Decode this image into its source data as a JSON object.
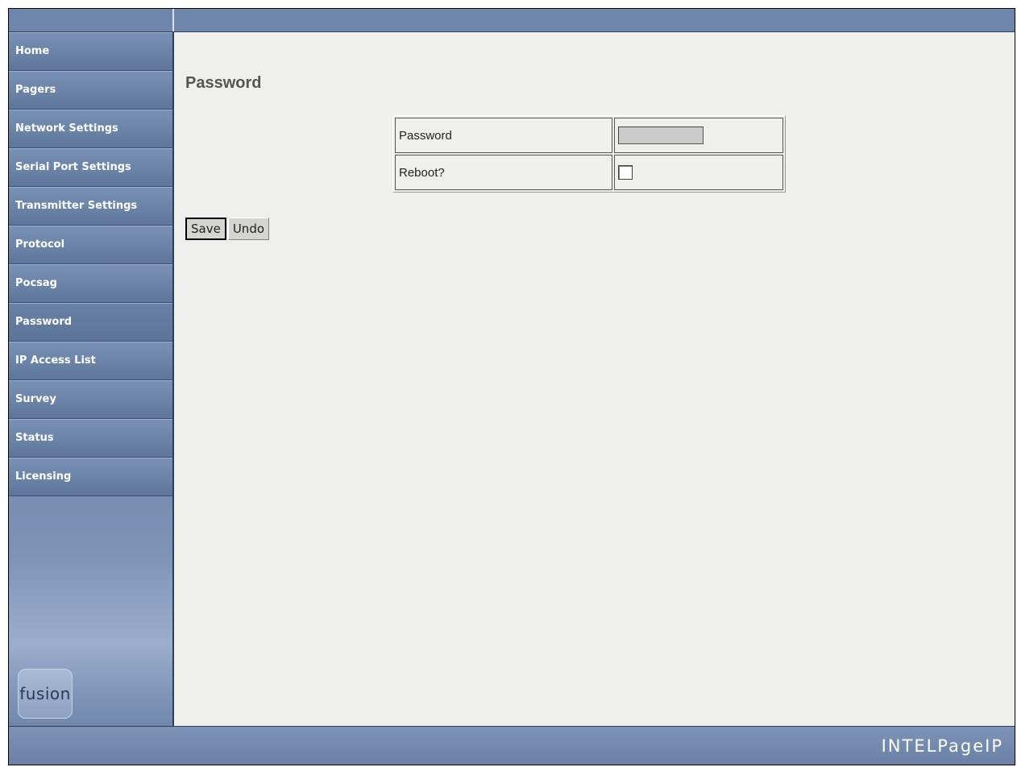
{
  "sidebar": {
    "items": [
      {
        "label": "Home"
      },
      {
        "label": "Pagers"
      },
      {
        "label": "Network Settings"
      },
      {
        "label": "Serial Port Settings"
      },
      {
        "label": "Transmitter Settings"
      },
      {
        "label": "Protocol"
      },
      {
        "label": "Pocsag"
      },
      {
        "label": "Password"
      },
      {
        "label": "IP Access List"
      },
      {
        "label": "Survey"
      },
      {
        "label": "Status"
      },
      {
        "label": "Licensing"
      }
    ],
    "logo_text": "fusion"
  },
  "main": {
    "title": "Password",
    "form": {
      "password_label": "Password",
      "password_value": "",
      "reboot_label": "Reboot?",
      "reboot_checked": false
    },
    "buttons": {
      "save_label": "Save",
      "undo_label": "Undo"
    }
  },
  "footer": {
    "brand": "INTELPageIP"
  }
}
